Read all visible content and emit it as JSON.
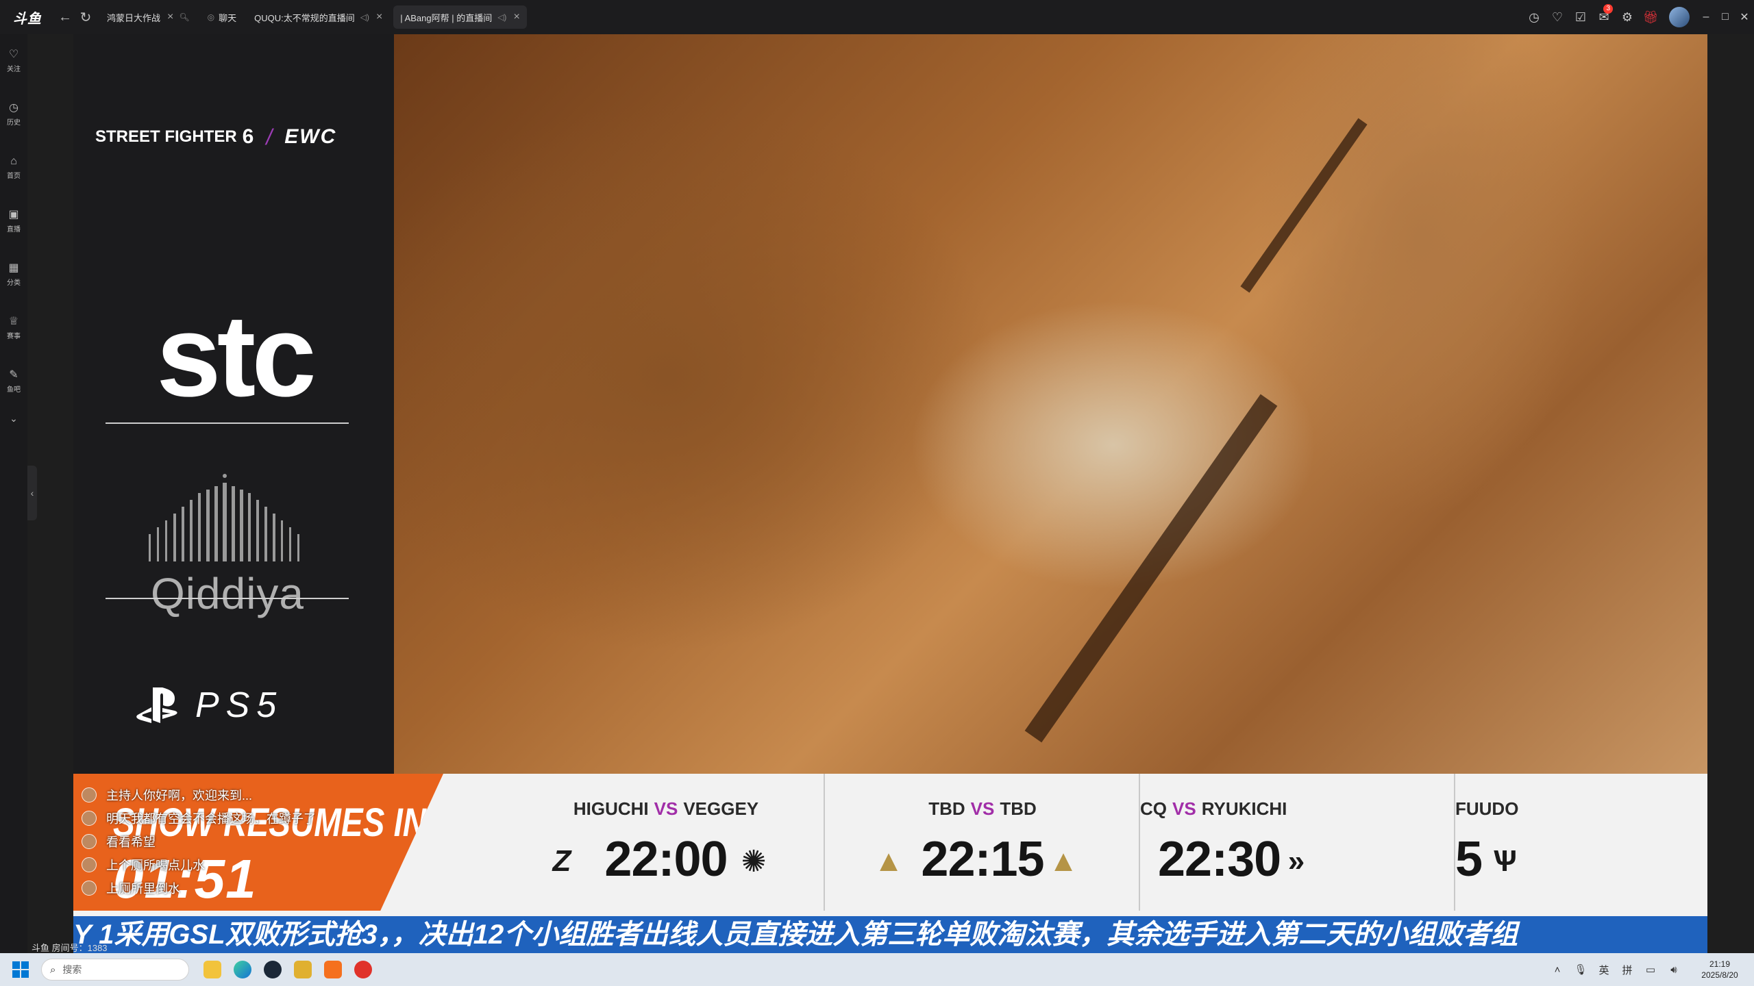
{
  "app": {
    "logo_text": "斗鱼"
  },
  "tabs": [
    {
      "label": "鸿蒙日大作战",
      "active": false
    },
    {
      "label": "聊天",
      "active": false
    },
    {
      "label": "QUQU:太不常规的直播间",
      "active": false
    },
    {
      "label": "| ABang阿帮 | 的直播间",
      "active": true
    }
  ],
  "titlebar": {
    "notif_count": "3"
  },
  "rail": [
    {
      "icon": "heart-icon",
      "glyph": "♡",
      "label": "关注"
    },
    {
      "icon": "history-icon",
      "glyph": "◷",
      "label": "历史"
    },
    {
      "icon": "home-icon",
      "glyph": "⌂",
      "label": "首页"
    },
    {
      "icon": "live-icon",
      "glyph": "▣",
      "label": "直播"
    },
    {
      "icon": "category-icon",
      "glyph": "▦",
      "label": "分类"
    },
    {
      "icon": "trophy-icon",
      "glyph": "♕",
      "label": "赛事"
    },
    {
      "icon": "fishbar-icon",
      "glyph": "✎",
      "label": "鱼吧"
    }
  ],
  "sponsors": {
    "sf_text": "STREET FIGHTER",
    "sf_num": "6",
    "slash": "/",
    "ewc": "EWC",
    "stc": "stc",
    "qiddiya": "Qiddiya",
    "ps5": "PS5"
  },
  "countdown": {
    "title": "SHOW RESUMES IN",
    "time": "01:51"
  },
  "chat": [
    "主持人你好啊，欢迎来到...",
    "明天我都有空会不会播这场，在蹲子了",
    "看看希望",
    "上个厕所喝点儿水",
    "上厕所里倒水"
  ],
  "matches": [
    {
      "p1": "HIGUCHI",
      "vs": "VS",
      "p2": "VEGGEY",
      "time": "22:00",
      "logo_left": "Z",
      "logo_right": "✺"
    },
    {
      "p1": "TBD",
      "vs": "VS",
      "p2": "TBD",
      "time": "22:15",
      "logo_left": "▲",
      "logo_right": "▲"
    },
    {
      "p1": "CQ",
      "vs": "VS",
      "p2": "RYUKICHI",
      "time": "22:30",
      "logo_left": "",
      "logo_right": "»"
    },
    {
      "p1": "FUUDO",
      "vs": "",
      "p2": "",
      "time": "5",
      "logo_left": "",
      "logo_right": "Ѱ"
    }
  ],
  "ticker": "Y 1采用GSL双败形式抢3，，决出12个小组胜者出线人员直接进入第三轮单败淘汰赛，其余选手进入第二天的小组败者组",
  "room_info": "斗鱼 房间号：1383",
  "taskbar": {
    "search_placeholder": "搜索",
    "ime_lang": "英",
    "ime_mode": "拼",
    "time": "21:19",
    "date": "2025/8/20"
  }
}
